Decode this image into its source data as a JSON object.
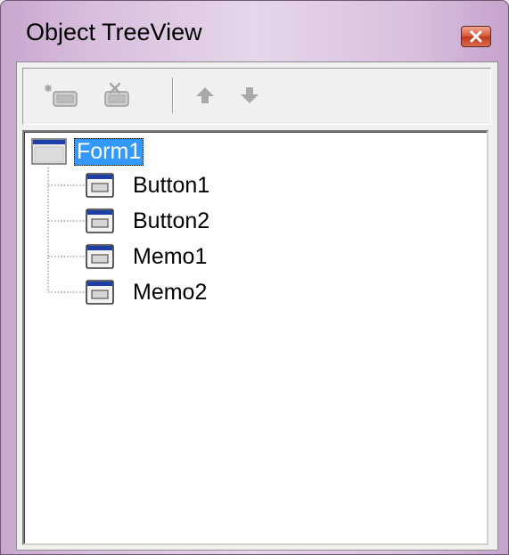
{
  "window": {
    "title": "Object TreeView",
    "close_tooltip": "Close"
  },
  "toolbar": {
    "buttons": [
      {
        "name": "add-component-button",
        "icon": "add-component-icon",
        "enabled": false
      },
      {
        "name": "delete-component-button",
        "icon": "delete-component-icon",
        "enabled": false
      },
      {
        "name": "move-up-button",
        "icon": "arrow-up-icon",
        "enabled": false
      },
      {
        "name": "move-down-button",
        "icon": "arrow-down-icon",
        "enabled": false
      }
    ]
  },
  "tree": {
    "root": {
      "label": "Form1",
      "icon": "form-icon",
      "selected": true
    },
    "children": [
      {
        "label": "Button1",
        "icon": "component-icon"
      },
      {
        "label": "Button2",
        "icon": "component-icon"
      },
      {
        "label": "Memo1",
        "icon": "component-icon"
      },
      {
        "label": "Memo2",
        "icon": "component-icon"
      }
    ]
  },
  "colors": {
    "selection": "#3399ff",
    "frame_accent": "#c9a6cf",
    "close_button": "#c2381c"
  }
}
